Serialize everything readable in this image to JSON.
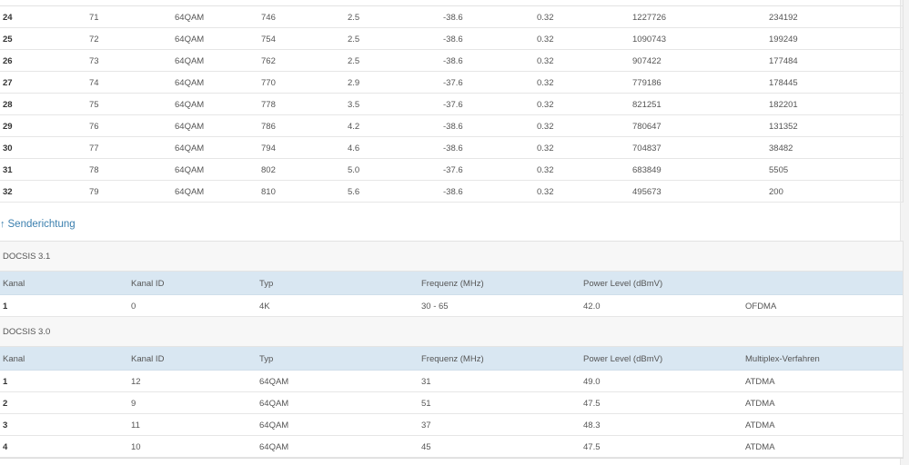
{
  "downstream": {
    "rows": [
      [
        "24",
        "71",
        "64QAM",
        "746",
        "2.5",
        "-38.6",
        "0.32",
        "1227726",
        "234192"
      ],
      [
        "25",
        "72",
        "64QAM",
        "754",
        "2.5",
        "-38.6",
        "0.32",
        "1090743",
        "199249"
      ],
      [
        "26",
        "73",
        "64QAM",
        "762",
        "2.5",
        "-38.6",
        "0.32",
        "907422",
        "177484"
      ],
      [
        "27",
        "74",
        "64QAM",
        "770",
        "2.9",
        "-37.6",
        "0.32",
        "779186",
        "178445"
      ],
      [
        "28",
        "75",
        "64QAM",
        "778",
        "3.5",
        "-37.6",
        "0.32",
        "821251",
        "182201"
      ],
      [
        "29",
        "76",
        "64QAM",
        "786",
        "4.2",
        "-38.6",
        "0.32",
        "780647",
        "131352"
      ],
      [
        "30",
        "77",
        "64QAM",
        "794",
        "4.6",
        "-38.6",
        "0.32",
        "704837",
        "38482"
      ],
      [
        "31",
        "78",
        "64QAM",
        "802",
        "5.0",
        "-37.6",
        "0.32",
        "683849",
        "5505"
      ],
      [
        "32",
        "79",
        "64QAM",
        "810",
        "5.6",
        "-38.6",
        "0.32",
        "495673",
        "200"
      ]
    ]
  },
  "upstream": {
    "title": "Senderichtung",
    "groups": [
      {
        "name": "DOCSIS 3.1",
        "headers": [
          "Kanal",
          "Kanal ID",
          "Typ",
          "Frequenz (MHz)",
          "Power Level (dBmV)",
          ""
        ],
        "rows": [
          [
            "1",
            "0",
            "4K",
            "30 - 65",
            "42.0",
            "OFDMA"
          ]
        ]
      },
      {
        "name": "DOCSIS 3.0",
        "headers": [
          "Kanal",
          "Kanal ID",
          "Typ",
          "Frequenz (MHz)",
          "Power Level (dBmV)",
          "Multiplex-Verfahren"
        ],
        "rows": [
          [
            "1",
            "12",
            "64QAM",
            "31",
            "49.0",
            "ATDMA"
          ],
          [
            "2",
            "9",
            "64QAM",
            "51",
            "47.5",
            "ATDMA"
          ],
          [
            "3",
            "11",
            "64QAM",
            "37",
            "48.3",
            "ATDMA"
          ],
          [
            "4",
            "10",
            "64QAM",
            "45",
            "47.5",
            "ATDMA"
          ]
        ]
      }
    ]
  }
}
